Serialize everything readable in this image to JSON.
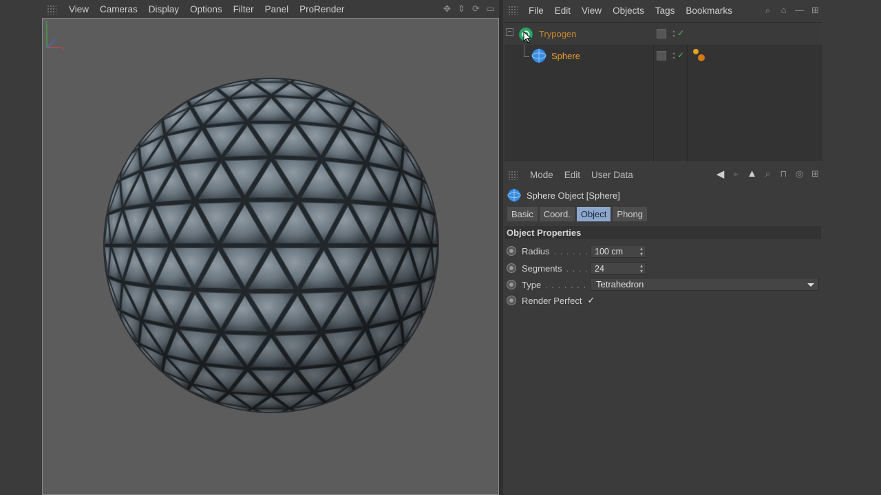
{
  "viewport": {
    "menu": [
      "View",
      "Cameras",
      "Display",
      "Options",
      "Filter",
      "Panel",
      "ProRender"
    ],
    "tool_icons": [
      "move-view-icon",
      "dolly-view-icon",
      "rotate-view-icon",
      "toggle-view-icon"
    ]
  },
  "object_manager": {
    "menu": [
      "File",
      "Edit",
      "View",
      "Objects",
      "Tags",
      "Bookmarks"
    ],
    "objects": [
      {
        "name": "Trypogen",
        "color": "#c98a2a",
        "icon": "generator-icon"
      },
      {
        "name": "Sphere",
        "color": "#f0a030",
        "icon": "sphere-icon"
      }
    ]
  },
  "attribute_manager": {
    "menu": [
      "Mode",
      "Edit",
      "User Data"
    ],
    "title": "Sphere Object [Sphere]",
    "tabs": [
      "Basic",
      "Coord.",
      "Object",
      "Phong"
    ],
    "active_tab": "Object",
    "section": "Object Properties",
    "properties": {
      "radius": {
        "label": "Radius",
        "dots": ". . . . . .",
        "value": "100 cm"
      },
      "segments": {
        "label": "Segments",
        "dots": ". . . .",
        "value": "24"
      },
      "type": {
        "label": "Type",
        "dots": ". . . . . . . .",
        "value": "Tetrahedron"
      },
      "render_perfect": {
        "label": "Render Perfect",
        "checked": "✓"
      }
    }
  },
  "colors": {
    "accent_tab": "#8ea7cf",
    "object_name": "#f0a030",
    "check": "#4fc04f"
  }
}
